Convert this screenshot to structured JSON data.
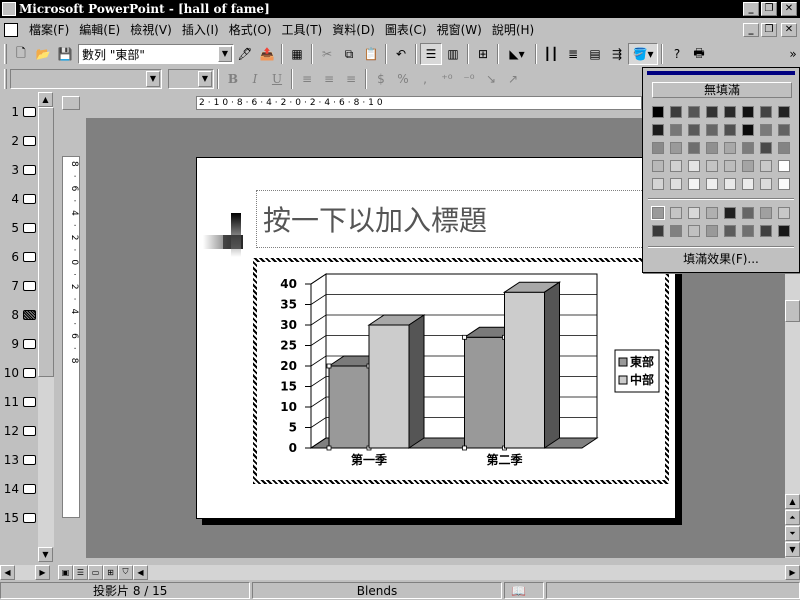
{
  "window": {
    "title": "Microsoft PowerPoint - [hall of fame]",
    "minimize_icon": "minimize-icon",
    "restore_icon": "restore-icon",
    "close_icon": "close-icon"
  },
  "menu": {
    "items": [
      "檔案(F)",
      "編輯(E)",
      "檢視(V)",
      "插入(I)",
      "格式(O)",
      "工具(T)",
      "資料(D)",
      "圖表(C)",
      "視窗(W)",
      "說明(H)"
    ]
  },
  "toolbar": {
    "series_combo": "數列 \"東部\"",
    "overflow": "»"
  },
  "formatting": {
    "font_combo": "",
    "size_combo": "",
    "bold": "B",
    "italic": "I",
    "underline": "U",
    "percent": "%",
    "comma": ","
  },
  "slides_panel": {
    "numbers": [
      "1",
      "2",
      "3",
      "4",
      "5",
      "6",
      "7",
      "8",
      "9",
      "10",
      "11",
      "12",
      "13",
      "14",
      "15"
    ],
    "selected_index": 8
  },
  "ruler": {
    "horizontal_labels": "2·10·8·6·4·2·0·2·4·6·8·10",
    "vertical_labels": "8·6·4·2·0·2·4·6·8"
  },
  "slide": {
    "title_placeholder": "按一下以加入標題"
  },
  "chart_data": {
    "type": "bar",
    "categories": [
      "第一季",
      "第二季"
    ],
    "series": [
      {
        "name": "東部",
        "values": [
          20,
          27
        ],
        "color": "#999999"
      },
      {
        "name": "中部",
        "values": [
          30,
          38
        ],
        "color": "#cccccc"
      }
    ],
    "ylim": [
      0,
      40
    ],
    "yticks": [
      "0",
      "5",
      "10",
      "15",
      "20",
      "25",
      "30",
      "35",
      "40"
    ],
    "grid": true,
    "legend": "right",
    "three_d": true
  },
  "color_menu": {
    "no_fill": "無填滿",
    "fill_effects": "填滿效果(F)...",
    "grid1": [
      "#000000",
      "#3c3c3c",
      "#555555",
      "#333333",
      "#2a2a2a",
      "#111111",
      "#444444",
      "#222222",
      "#1c1c1c",
      "#777777",
      "#5a5a5a",
      "#666666",
      "#505050",
      "#0a0a0a",
      "#7a7a7a",
      "#626262",
      "#8a8a8a",
      "#9a9a9a",
      "#6e6e6e",
      "#909090",
      "#a8a8a8",
      "#7c7c7c",
      "#4a4a4a",
      "#848484",
      "#b8b8b8",
      "#d0d0d0",
      "#e4e4e4",
      "#c4c4c4",
      "#bcbcbc",
      "#a4a4a4",
      "#c8c8c8",
      "#ffffff",
      "#d4d4d4",
      "#e0e0e0",
      "#f4f4f4",
      "#eeeeee",
      "#e8e8e8",
      "#ececec",
      "#dcdcdc",
      "#fafafa"
    ],
    "grid2": [
      "#9a9a9a",
      "#c4c4c4",
      "#d8d8d8",
      "#b0b0b0",
      "#202020",
      "#666666",
      "#a0a0a0",
      "#c8c8c8",
      "#3a3a3a",
      "#808080",
      "#c0c0c0",
      "#999999",
      "#5c5c5c",
      "#707070",
      "#404040",
      "#181818"
    ]
  },
  "status": {
    "slide": "投影片 8 / 15",
    "design": "Blends"
  }
}
